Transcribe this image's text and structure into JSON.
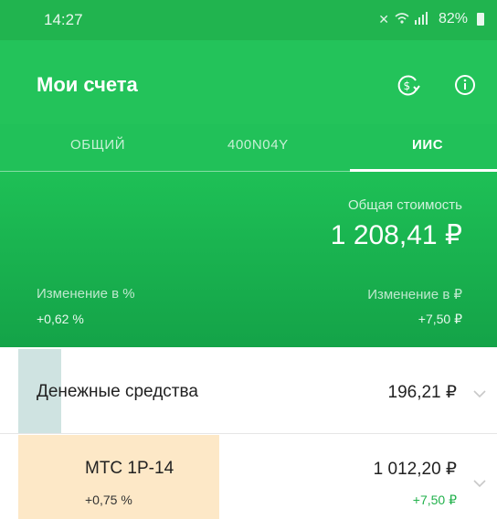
{
  "status": {
    "time": "14:27",
    "battery": "82%"
  },
  "header": {
    "title": "Мои счета",
    "icons": [
      "exchange-rub-icon",
      "info-icon"
    ]
  },
  "tabs": [
    {
      "label": "ОБЩИЙ",
      "active": false
    },
    {
      "label": "400N04Y",
      "active": false
    },
    {
      "label": "ИИС",
      "active": true
    }
  ],
  "summary": {
    "total_label": "Общая стоимость",
    "total_value": "1 208,41 ₽",
    "change_pct_label": "Изменение в %",
    "change_pct_value": "+0,62 %",
    "change_rub_label": "Изменение в ₽",
    "change_rub_value": "+7,50 ₽"
  },
  "positions": [
    {
      "name": "Денежные средства",
      "value": "196,21 ₽",
      "bar_fraction": 0.09
    },
    {
      "name": "МТС 1Р-14",
      "change": "+0,75 %",
      "value": "1 012,20 ₽",
      "value_change": "+7,50 ₽",
      "bar_fraction": 0.42
    }
  ],
  "colors": {
    "primary_green": "#23c35a",
    "cash_bar": "#cfe3e1",
    "bond_bar": "#fde8c7",
    "positive": "#22b14c"
  }
}
